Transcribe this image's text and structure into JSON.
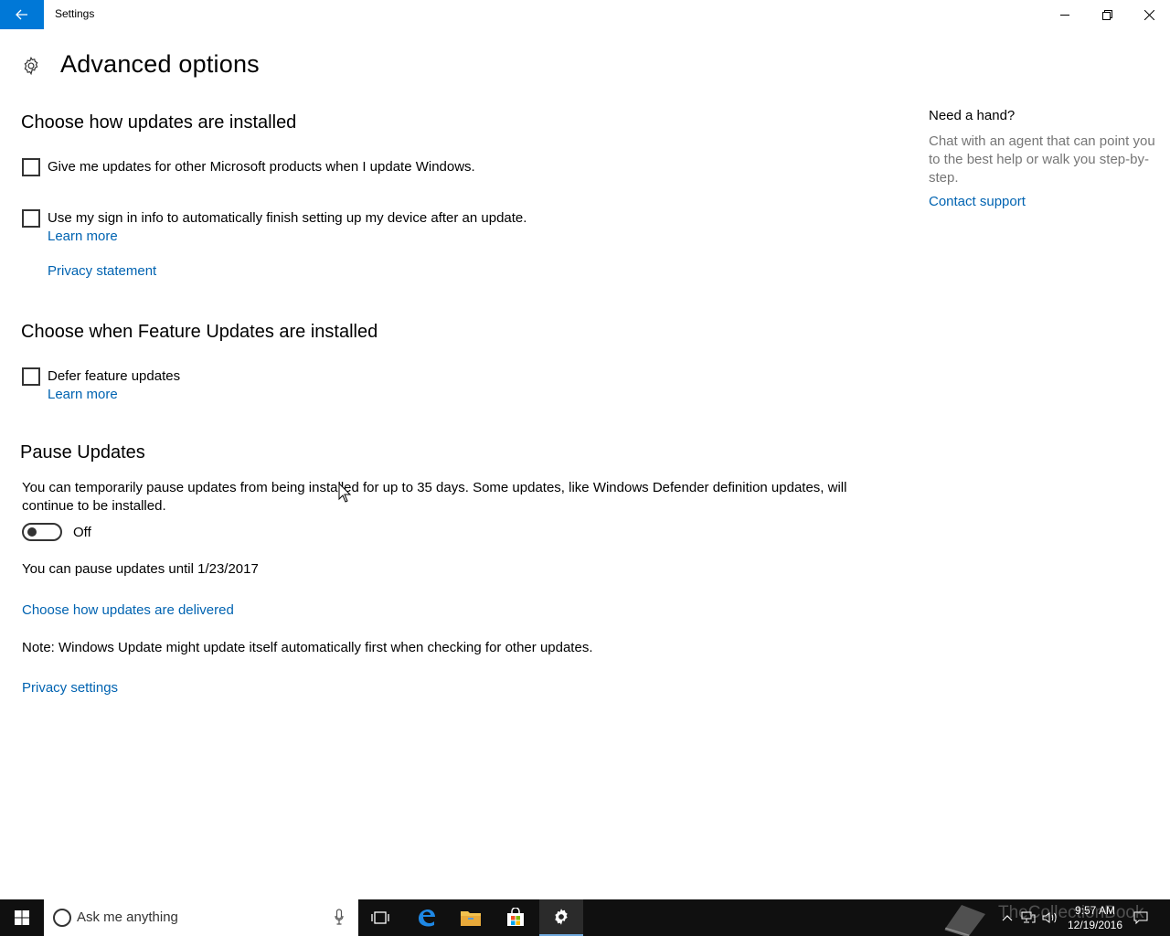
{
  "window": {
    "app_title": "Settings"
  },
  "page": {
    "title": "Advanced options"
  },
  "section_install": {
    "heading": "Choose how updates are installed",
    "option_ms_products": "Give me updates for other Microsoft products when I update Windows.",
    "option_sign_in": "Use my sign in info to automatically finish setting up my device after an update.",
    "learn_more": "Learn more",
    "privacy_statement": "Privacy statement"
  },
  "section_feature": {
    "heading": "Choose when Feature Updates are installed",
    "option_defer": "Defer feature updates",
    "learn_more": "Learn more"
  },
  "section_pause": {
    "heading": "Pause Updates",
    "description": "You can temporarily pause updates from being installed for up to 35 days. Some updates, like Windows Defender definition updates, will continue to be installed.",
    "toggle_state": "Off",
    "pause_until": "You can pause updates until 1/23/2017"
  },
  "links": {
    "delivery": "Choose how updates are delivered",
    "privacy_settings": "Privacy settings"
  },
  "note": "Note: Windows Update might update itself automatically first when checking for other updates.",
  "help": {
    "title": "Need a hand?",
    "text": "Chat with an agent that can point you to the best help or walk you step-by-step.",
    "link": "Contact support"
  },
  "taskbar": {
    "search_placeholder": "Ask me anything",
    "time": "9:57 AM",
    "date": "12/19/2016",
    "watermark": "TheCollectionBook"
  },
  "colors": {
    "accent": "#0078d7",
    "link": "#0063b1",
    "taskbar": "#101010"
  }
}
